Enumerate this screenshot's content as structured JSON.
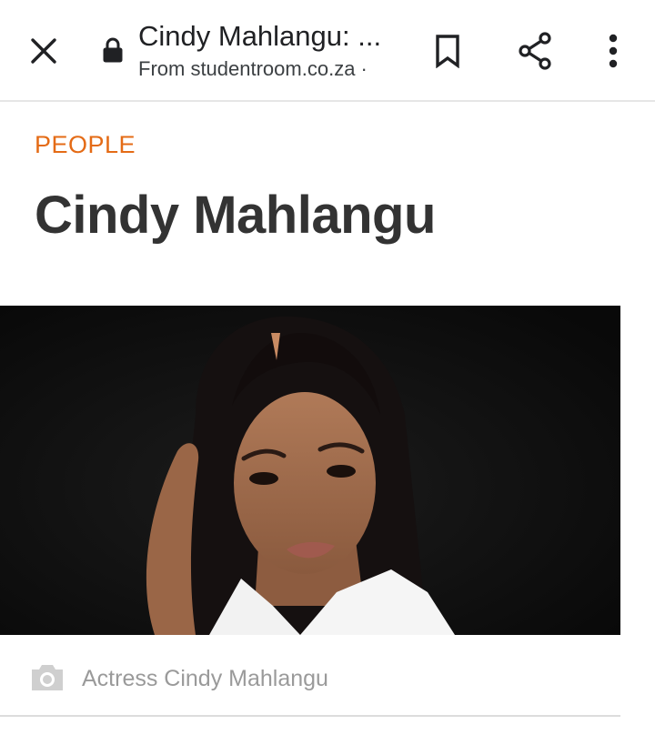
{
  "toolbar": {
    "title": "Cindy Mahlangu: ...",
    "source": "From studentroom.co.za ·"
  },
  "article": {
    "category": "PEOPLE",
    "headline": "Cindy Mahlangu",
    "image_caption": "Actress Cindy Mahlangu"
  },
  "colors": {
    "accent": "#e46b16",
    "headline": "#333333",
    "caption": "#9a9a9a"
  },
  "icons": [
    "close-icon",
    "lock-icon",
    "bookmark-icon",
    "share-icon",
    "more-vert-icon",
    "camera-icon"
  ]
}
